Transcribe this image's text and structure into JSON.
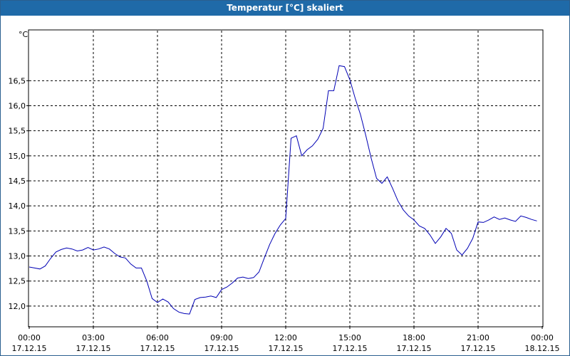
{
  "window": {
    "title": "Temperatur [°C] skaliert"
  },
  "chart_data": {
    "type": "line",
    "title": "Temperatur [°C] skaliert",
    "ylabel": "°C",
    "xlabel": "",
    "ylim": [
      11.6,
      17.5
    ],
    "xlim_hours": [
      0,
      24
    ],
    "grid": true,
    "line_color": "#0000b4",
    "x_ticks": [
      {
        "time": "00:00",
        "date": "17.12.15"
      },
      {
        "time": "03:00",
        "date": "17.12.15"
      },
      {
        "time": "06:00",
        "date": "17.12.15"
      },
      {
        "time": "09:00",
        "date": "17.12.15"
      },
      {
        "time": "12:00",
        "date": "17.12.15"
      },
      {
        "time": "15:00",
        "date": "17.12.15"
      },
      {
        "time": "18:00",
        "date": "17.12.15"
      },
      {
        "time": "21:00",
        "date": "17.12.15"
      },
      {
        "time": "00:00",
        "date": "18.12.15"
      }
    ],
    "y_ticks": [
      "12,0",
      "12,5",
      "13,0",
      "13,5",
      "14,0",
      "14,5",
      "15,0",
      "15,5",
      "16,0",
      "16,5"
    ],
    "series": [
      {
        "x": [
          "17.12.15 00:00",
          "17.12.15 00:15",
          "17.12.15 00:30",
          "17.12.15 00:45",
          "17.12.15 01:00",
          "17.12.15 01:15",
          "17.12.15 01:30",
          "17.12.15 01:45",
          "17.12.15 02:00",
          "17.12.15 02:15",
          "17.12.15 02:30",
          "17.12.15 02:45",
          "17.12.15 03:00",
          "17.12.15 03:15",
          "17.12.15 03:30",
          "17.12.15 03:45",
          "17.12.15 04:00",
          "17.12.15 04:15",
          "17.12.15 04:30",
          "17.12.15 04:45",
          "17.12.15 05:00",
          "17.12.15 05:15",
          "17.12.15 05:30",
          "17.12.15 05:45",
          "17.12.15 06:00",
          "17.12.15 06:15",
          "17.12.15 06:30",
          "17.12.15 06:45",
          "17.12.15 07:00",
          "17.12.15 07:15",
          "17.12.15 07:30",
          "17.12.15 07:45",
          "17.12.15 08:00",
          "17.12.15 08:15",
          "17.12.15 08:30",
          "17.12.15 08:45",
          "17.12.15 09:00",
          "17.12.15 09:15",
          "17.12.15 09:30",
          "17.12.15 09:45",
          "17.12.15 10:00",
          "17.12.15 10:15",
          "17.12.15 10:30",
          "17.12.15 10:45",
          "17.12.15 11:00",
          "17.12.15 11:15",
          "17.12.15 11:30",
          "17.12.15 11:45",
          "17.12.15 12:00",
          "17.12.15 12:15",
          "17.12.15 12:30",
          "17.12.15 12:45",
          "17.12.15 13:00",
          "17.12.15 13:15",
          "17.12.15 13:30",
          "17.12.15 13:45",
          "17.12.15 14:00",
          "17.12.15 14:15",
          "17.12.15 14:30",
          "17.12.15 14:45",
          "17.12.15 15:00",
          "17.12.15 15:15",
          "17.12.15 15:30",
          "17.12.15 15:45",
          "17.12.15 16:00",
          "17.12.15 16:15",
          "17.12.15 16:30",
          "17.12.15 16:45",
          "17.12.15 17:00",
          "17.12.15 17:15",
          "17.12.15 17:30",
          "17.12.15 17:45",
          "17.12.15 18:00",
          "17.12.15 18:15",
          "17.12.15 18:30",
          "17.12.15 18:45",
          "17.12.15 19:00",
          "17.12.15 19:15",
          "17.12.15 19:30",
          "17.12.15 19:45",
          "17.12.15 20:00",
          "17.12.15 20:15",
          "17.12.15 20:30",
          "17.12.15 20:45",
          "17.12.15 21:00",
          "17.12.15 21:15",
          "17.12.15 21:30",
          "17.12.15 21:45",
          "17.12.15 22:00",
          "17.12.15 22:15",
          "17.12.15 22:30",
          "17.12.15 22:45",
          "17.12.15 23:00",
          "17.12.15 23:15",
          "17.12.15 23:30",
          "17.12.15 23:45"
        ],
        "y": [
          12.78,
          12.76,
          12.74,
          12.8,
          12.95,
          13.08,
          13.13,
          13.16,
          13.14,
          13.1,
          13.12,
          13.17,
          13.12,
          13.14,
          13.18,
          13.14,
          13.05,
          12.98,
          12.96,
          12.84,
          12.76,
          12.76,
          12.5,
          12.15,
          12.07,
          12.14,
          12.08,
          11.95,
          11.88,
          11.85,
          11.84,
          12.13,
          12.17,
          12.18,
          12.2,
          12.17,
          12.33,
          12.38,
          12.46,
          12.56,
          12.58,
          12.55,
          12.57,
          12.68,
          12.96,
          13.23,
          13.45,
          13.62,
          13.75,
          15.35,
          15.4,
          15.0,
          15.12,
          15.2,
          15.33,
          15.55,
          16.3,
          16.3,
          16.8,
          16.78,
          16.52,
          16.15,
          15.82,
          15.4,
          14.95,
          14.55,
          14.45,
          14.58,
          14.35,
          14.1,
          13.92,
          13.8,
          13.72,
          13.6,
          13.55,
          13.42,
          13.25,
          13.38,
          13.55,
          13.45,
          13.12,
          13.02,
          13.15,
          13.35,
          13.68,
          13.67,
          13.72,
          13.78,
          13.73,
          13.76,
          13.72,
          13.69,
          13.8,
          13.77,
          13.73,
          13.7
        ]
      }
    ]
  }
}
